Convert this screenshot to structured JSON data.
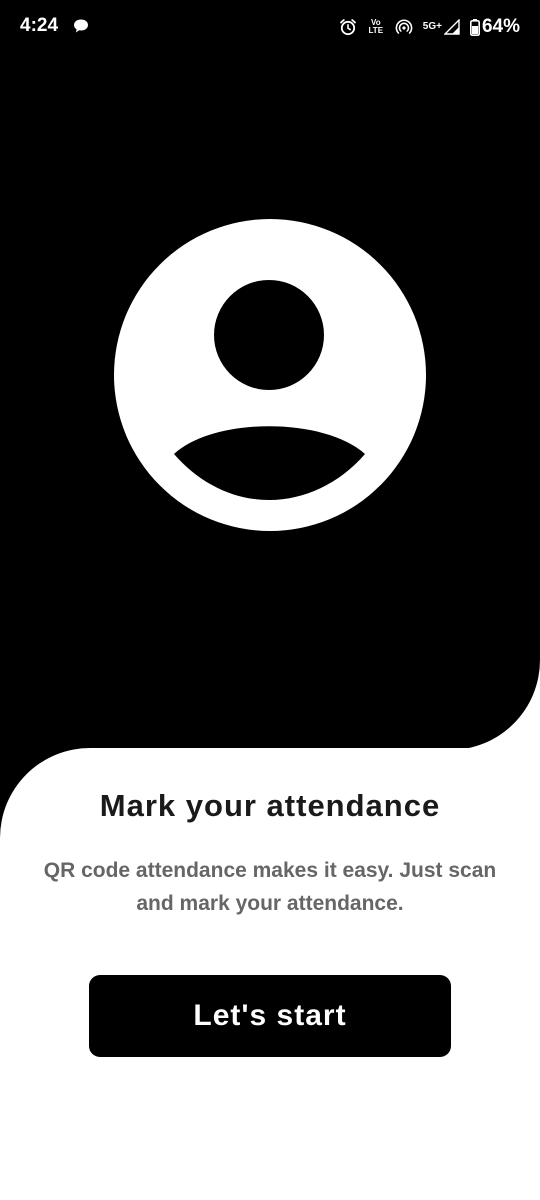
{
  "status_bar": {
    "time": "4:24",
    "battery": "64%",
    "volte_top": "Vo",
    "volte_bottom": "LTE",
    "network": "5G+",
    "icons": [
      "message-icon",
      "alarm-icon",
      "volte-icon",
      "hotspot-icon",
      "signal-icon",
      "battery-icon"
    ]
  },
  "hero": {
    "illustration": "user-avatar-icon"
  },
  "content": {
    "title": "Mark your attendance",
    "description": "QR code attendance makes it easy. Just scan and mark your attendance."
  },
  "actions": {
    "start_label": "Let's start"
  },
  "colors": {
    "hero_bg": "#000000",
    "card_bg": "#ffffff",
    "title": "#1a1a1a",
    "description": "#666666",
    "button_bg": "#000000",
    "button_text": "#ffffff"
  }
}
